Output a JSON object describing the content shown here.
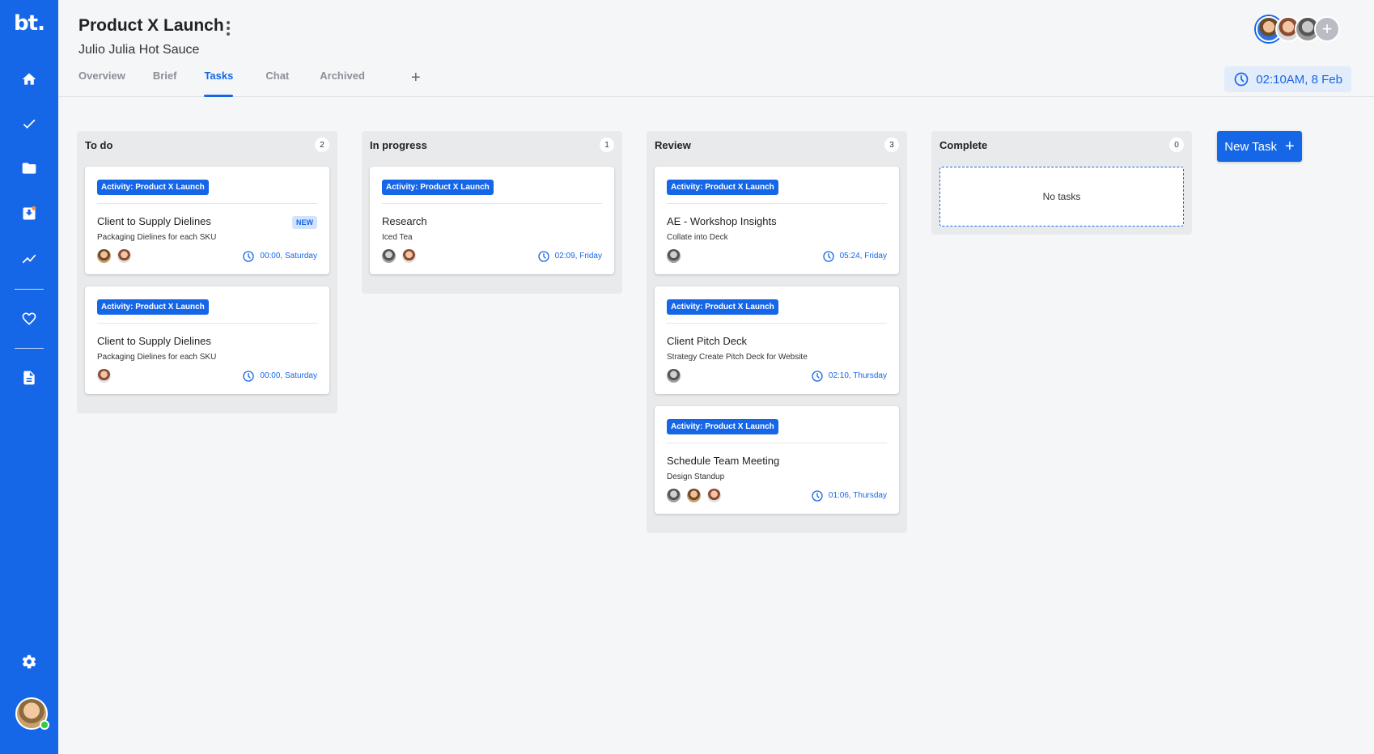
{
  "app": {
    "logo_text": "bt."
  },
  "sidebar": {
    "items": [
      {
        "name": "home",
        "icon": "home-icon"
      },
      {
        "name": "tasks",
        "icon": "check-icon"
      },
      {
        "name": "files",
        "icon": "folder-icon"
      },
      {
        "name": "inbox",
        "icon": "inbox-download-icon"
      },
      {
        "name": "analytics",
        "icon": "trend-icon"
      },
      {
        "name": "favorites",
        "icon": "heart-icon"
      },
      {
        "name": "documents",
        "icon": "document-icon"
      },
      {
        "name": "settings",
        "icon": "gear-icon"
      }
    ],
    "user_online": true
  },
  "header": {
    "title": "Product X Launch",
    "client": "Julio Julia Hot Sauce",
    "tabs": [
      {
        "label": "Overview",
        "active": false
      },
      {
        "label": "Brief",
        "active": false
      },
      {
        "label": "Tasks",
        "active": true
      },
      {
        "label": "Chat",
        "active": false
      },
      {
        "label": "Archived",
        "active": false
      }
    ],
    "add_tab": "+",
    "datetime": "02:10AM, 8 Feb",
    "add_member": "+"
  },
  "board": {
    "columns": [
      {
        "title": "To do",
        "count": "2",
        "cards": [
          {
            "tag": "Activity:  Product X Launch",
            "title": "Client to Supply Dielines",
            "subtitle": "Packaging Dielines for each SKU",
            "badge": "NEW",
            "due": "00:00, Saturday"
          },
          {
            "tag": "Activity:  Product X Launch",
            "title": "Client to Supply Dielines",
            "subtitle": "Packaging Dielines for each SKU",
            "due": "00:00, Saturday"
          }
        ]
      },
      {
        "title": "In progress",
        "count": "1",
        "cards": [
          {
            "tag": "Activity:  Product X Launch",
            "title": "Research",
            "subtitle": "Iced Tea",
            "due": "02:09, Friday"
          }
        ]
      },
      {
        "title": "Review",
        "count": "3",
        "cards": [
          {
            "tag": "Activity:  Product X Launch",
            "title": "AE - Workshop Insights",
            "subtitle": "Collate into Deck",
            "due": "05:24, Friday"
          },
          {
            "tag": "Activity:  Product X Launch",
            "title": "Client Pitch Deck",
            "subtitle": "Strategy Create Pitch Deck for Website",
            "due": "02:10, Thursday"
          },
          {
            "tag": "Activity:  Product X Launch",
            "title": "Schedule Team Meeting",
            "subtitle": "Design Standup",
            "due": "01:06, Thursday"
          }
        ]
      },
      {
        "title": "Complete",
        "count": "0",
        "empty_text": "No tasks"
      }
    ],
    "new_task_label": "New Task",
    "new_task_icon": "+"
  },
  "colors": {
    "primary": "#1667e8",
    "tag_bg": "#1667e8",
    "badge_bg": "#d3e3fb",
    "online": "#2ecc40"
  }
}
